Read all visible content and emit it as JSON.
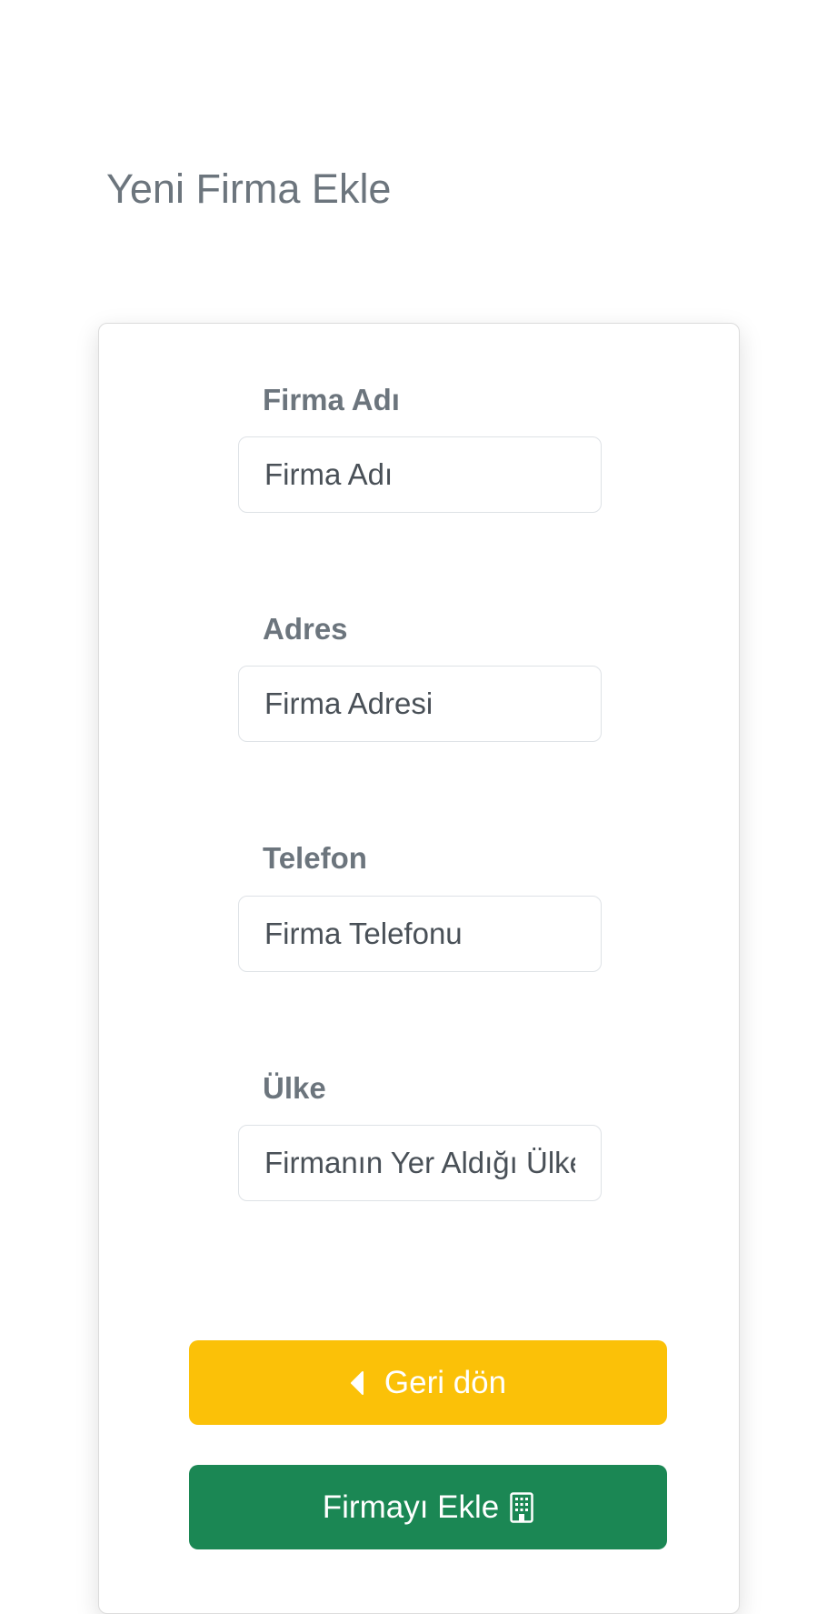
{
  "page": {
    "title": "Yeni Firma Ekle"
  },
  "form": {
    "fields": [
      {
        "label": "Firma Adı",
        "placeholder": "Firma Adı",
        "value": ""
      },
      {
        "label": "Adres",
        "placeholder": "Firma Adresi",
        "value": ""
      },
      {
        "label": "Telefon",
        "placeholder": "Firma Telefonu",
        "value": ""
      },
      {
        "label": "Ülke",
        "placeholder": "Firmanın Yer Aldığı Ülke",
        "value": ""
      }
    ]
  },
  "buttons": {
    "back_label": "Geri dön",
    "back_icon": "caret-left-icon",
    "add_label": "Firmayı Ekle",
    "add_icon": "building-icon"
  },
  "colors": {
    "title": "#6c757d",
    "back_button": "#fbc108",
    "add_button": "#1b8754"
  }
}
